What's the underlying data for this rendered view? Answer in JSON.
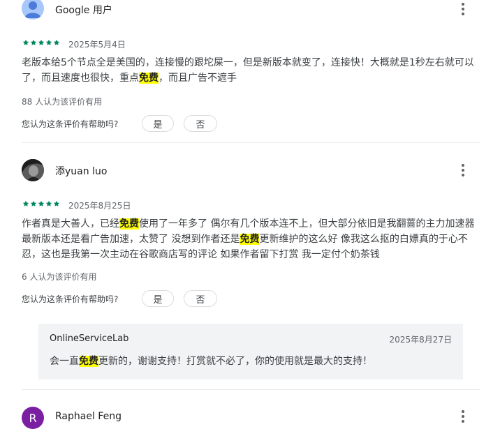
{
  "reviews": [
    {
      "author": "Google 用户",
      "date": "2025年5月4日",
      "rating": 5,
      "body": {
        "p1": "老版本给5个节点全是美国的，连接慢的跟坨屎一，但是新版本就变了，连接快！大概就是1秒左右就可以了，而且速度也很快，重点",
        "hl1": "免费",
        "p2": "，而且广告不遮手"
      },
      "helpful_count": "88 人认为该评价有用"
    },
    {
      "author": "添yuan luo",
      "date": "2025年8月25日",
      "rating": 5,
      "body": {
        "p1": "作者真是大善人，已经",
        "hl1": "免费",
        "p2": "使用了一年多了 偶尔有几个版本连不上，但大部分依旧是我翻蔷的主力加速器 最新版本还是看广告加速，太赞了 没想到作者还是",
        "hl2": "免费",
        "p3": "更新维护的这么好 像我这么抠的白嫖真的于心不忍，这也是我第一次主动在谷歌商店写的评论 如果作者留下打赏 我一定付个奶茶钱"
      },
      "helpful_count": "6 人认为该评价有用",
      "reply": {
        "developer": "OnlineServiceLab",
        "date": "2025年8月27日",
        "p1": "会一直",
        "hl1": "免费",
        "p2": "更新的，谢谢支持！打赏就不必了，你的使用就是最大的支持！"
      }
    },
    {
      "author": "Raphael Feng",
      "avatar_letter": "R"
    }
  ],
  "ui": {
    "helpful_question": "您认为这条评价有帮助吗?",
    "yes": "是",
    "no": "否"
  },
  "colors": {
    "star": "#01875f",
    "highlight": "#ffff00",
    "avatar_default": "#a8c7fa",
    "avatar_r": "#7b1fa2"
  }
}
